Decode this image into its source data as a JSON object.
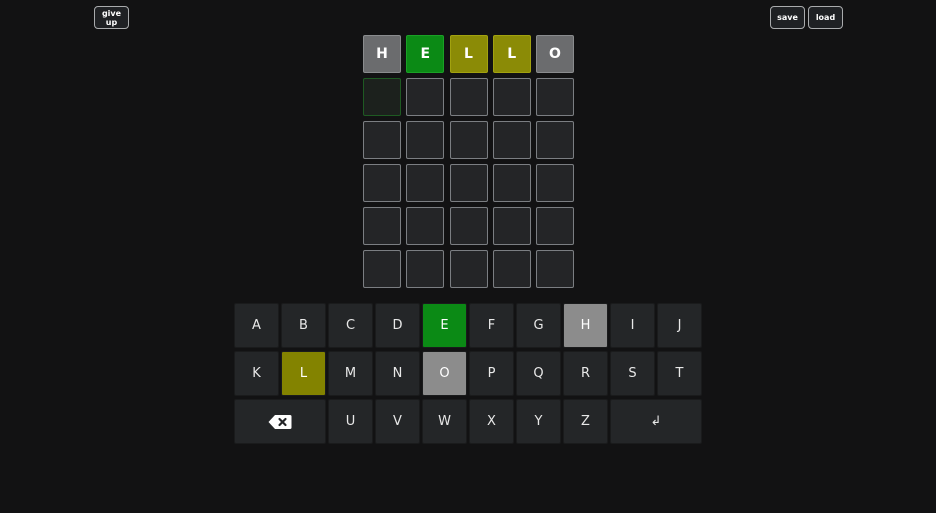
{
  "header": {
    "give_up_label": "give up",
    "save_label": "save",
    "load_label": "load"
  },
  "board": {
    "rows": [
      [
        {
          "letter": "H",
          "state": "absent"
        },
        {
          "letter": "E",
          "state": "correct"
        },
        {
          "letter": "L",
          "state": "present"
        },
        {
          "letter": "L",
          "state": "present"
        },
        {
          "letter": "O",
          "state": "absent"
        }
      ],
      [
        {
          "letter": "",
          "state": "active"
        },
        {
          "letter": "",
          "state": "empty"
        },
        {
          "letter": "",
          "state": "empty"
        },
        {
          "letter": "",
          "state": "empty"
        },
        {
          "letter": "",
          "state": "empty"
        }
      ],
      [
        {
          "letter": "",
          "state": "empty"
        },
        {
          "letter": "",
          "state": "empty"
        },
        {
          "letter": "",
          "state": "empty"
        },
        {
          "letter": "",
          "state": "empty"
        },
        {
          "letter": "",
          "state": "empty"
        }
      ],
      [
        {
          "letter": "",
          "state": "empty"
        },
        {
          "letter": "",
          "state": "empty"
        },
        {
          "letter": "",
          "state": "empty"
        },
        {
          "letter": "",
          "state": "empty"
        },
        {
          "letter": "",
          "state": "empty"
        }
      ],
      [
        {
          "letter": "",
          "state": "empty"
        },
        {
          "letter": "",
          "state": "empty"
        },
        {
          "letter": "",
          "state": "empty"
        },
        {
          "letter": "",
          "state": "empty"
        },
        {
          "letter": "",
          "state": "empty"
        }
      ],
      [
        {
          "letter": "",
          "state": "empty"
        },
        {
          "letter": "",
          "state": "empty"
        },
        {
          "letter": "",
          "state": "empty"
        },
        {
          "letter": "",
          "state": "empty"
        },
        {
          "letter": "",
          "state": "empty"
        }
      ]
    ]
  },
  "keyboard": {
    "rows": [
      [
        {
          "label": "A",
          "state": "unused"
        },
        {
          "label": "B",
          "state": "unused"
        },
        {
          "label": "C",
          "state": "unused"
        },
        {
          "label": "D",
          "state": "unused"
        },
        {
          "label": "E",
          "state": "correct"
        },
        {
          "label": "F",
          "state": "unused"
        },
        {
          "label": "G",
          "state": "unused"
        },
        {
          "label": "H",
          "state": "absent"
        },
        {
          "label": "I",
          "state": "unused"
        },
        {
          "label": "J",
          "state": "unused"
        }
      ],
      [
        {
          "label": "K",
          "state": "unused"
        },
        {
          "label": "L",
          "state": "present"
        },
        {
          "label": "M",
          "state": "unused"
        },
        {
          "label": "N",
          "state": "unused"
        },
        {
          "label": "O",
          "state": "absent"
        },
        {
          "label": "P",
          "state": "unused"
        },
        {
          "label": "Q",
          "state": "unused"
        },
        {
          "label": "R",
          "state": "unused"
        },
        {
          "label": "S",
          "state": "unused"
        },
        {
          "label": "T",
          "state": "unused"
        }
      ],
      [
        {
          "label": "",
          "state": "unused",
          "icon": "backspace-icon",
          "wide": true
        },
        {
          "label": "U",
          "state": "unused"
        },
        {
          "label": "V",
          "state": "unused"
        },
        {
          "label": "W",
          "state": "unused"
        },
        {
          "label": "X",
          "state": "unused"
        },
        {
          "label": "Y",
          "state": "unused"
        },
        {
          "label": "Z",
          "state": "unused"
        },
        {
          "label": "↲",
          "state": "unused",
          "wide": true
        }
      ]
    ]
  },
  "colors": {
    "background": "#121213",
    "correct": "#0b8a15",
    "present": "#8b8b06",
    "absent": "#6b6c6e",
    "key_absent": "#8c8c8c",
    "key_unused": "#242628"
  }
}
